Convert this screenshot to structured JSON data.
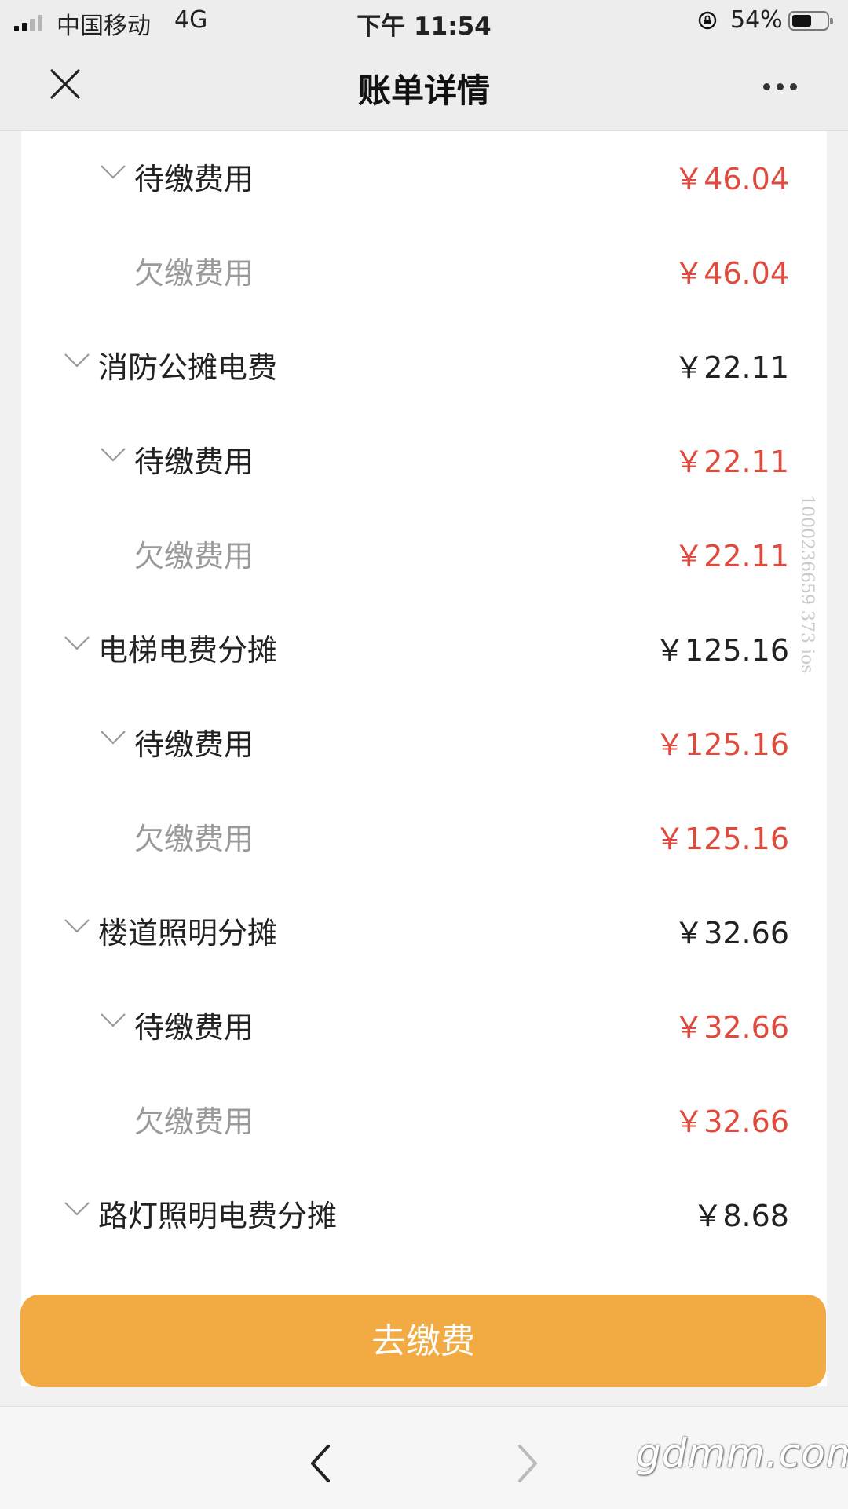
{
  "status_bar": {
    "carrier": "中国移动",
    "network": "4G",
    "time": "下午 11:54",
    "battery": "54%",
    "battery_level": 0.54
  },
  "nav": {
    "title": "账单详情",
    "close_icon": "close-icon",
    "more_icon": "more-icon"
  },
  "bill": {
    "rows": [
      {
        "level": 1,
        "label": "待缴费用",
        "amount": "￥46.04",
        "expanded": true
      },
      {
        "level": 2,
        "label": "欠缴费用",
        "amount": "￥46.04"
      },
      {
        "level": 0,
        "label": "消防公摊电费",
        "amount": "￥22.11",
        "expanded": true
      },
      {
        "level": 1,
        "label": "待缴费用",
        "amount": "￥22.11",
        "expanded": true
      },
      {
        "level": 2,
        "label": "欠缴费用",
        "amount": "￥22.11"
      },
      {
        "level": 0,
        "label": "电梯电费分摊",
        "amount": "￥125.16",
        "expanded": true
      },
      {
        "level": 1,
        "label": "待缴费用",
        "amount": "￥125.16",
        "expanded": true
      },
      {
        "level": 2,
        "label": "欠缴费用",
        "amount": "￥125.16"
      },
      {
        "level": 0,
        "label": "楼道照明分摊",
        "amount": "￥32.66",
        "expanded": true
      },
      {
        "level": 1,
        "label": "待缴费用",
        "amount": "￥32.66",
        "expanded": true
      },
      {
        "level": 2,
        "label": "欠缴费用",
        "amount": "￥32.66"
      },
      {
        "level": 0,
        "label": "路灯照明电费分摊",
        "amount": "￥8.68",
        "expanded": true
      }
    ],
    "pay_button": "去缴费"
  },
  "watermarks": {
    "side_id": "1000236659 373 ios",
    "site": "gdmm.com"
  },
  "colors": {
    "accent": "#f2ab42",
    "amount_red": "#e04a3c",
    "background": "#f1f1f1"
  }
}
